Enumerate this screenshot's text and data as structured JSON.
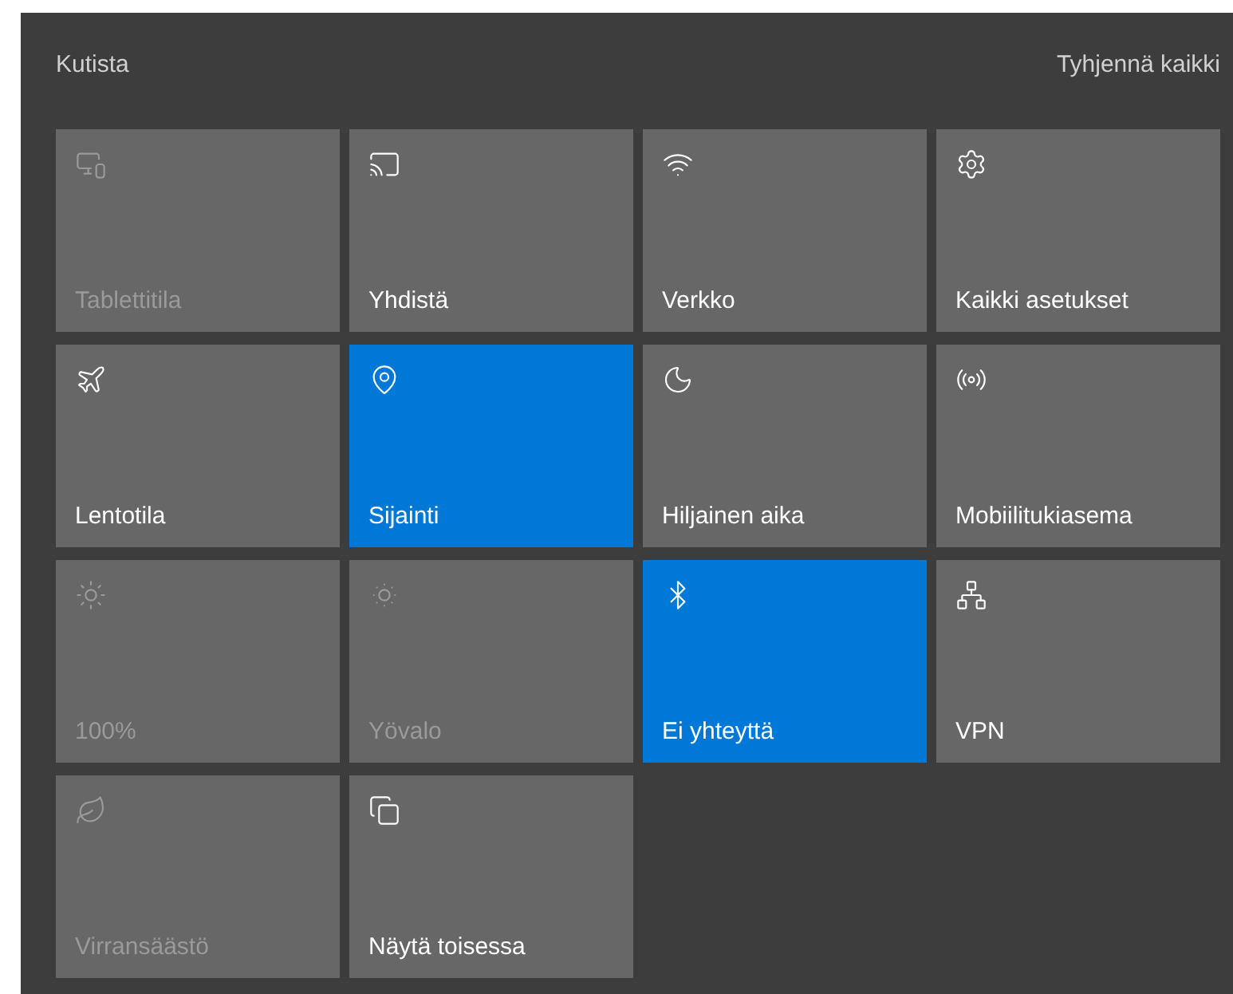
{
  "header": {
    "collapse": "Kutista",
    "clear_all": "Tyhjennä kaikki"
  },
  "tiles": [
    {
      "label": "Tablettitila",
      "on": false,
      "disabled": true
    },
    {
      "label": "Yhdistä",
      "on": false,
      "disabled": false
    },
    {
      "label": "Verkko",
      "on": false,
      "disabled": false
    },
    {
      "label": "Kaikki asetukset",
      "on": false,
      "disabled": false
    },
    {
      "label": "Lentotila",
      "on": false,
      "disabled": false
    },
    {
      "label": "Sijainti",
      "on": true,
      "disabled": false
    },
    {
      "label": "Hiljainen aika",
      "on": false,
      "disabled": false
    },
    {
      "label": "Mobiilitukiasema",
      "on": false,
      "disabled": false
    },
    {
      "label": "100%",
      "on": false,
      "disabled": true
    },
    {
      "label": "Yövalo",
      "on": false,
      "disabled": true
    },
    {
      "label": "Ei yhteyttä",
      "on": true,
      "disabled": false
    },
    {
      "label": "VPN",
      "on": false,
      "disabled": false
    },
    {
      "label": "Virransäästö",
      "on": false,
      "disabled": true
    },
    {
      "label": "Näytä toisessa",
      "on": false,
      "disabled": false
    }
  ]
}
